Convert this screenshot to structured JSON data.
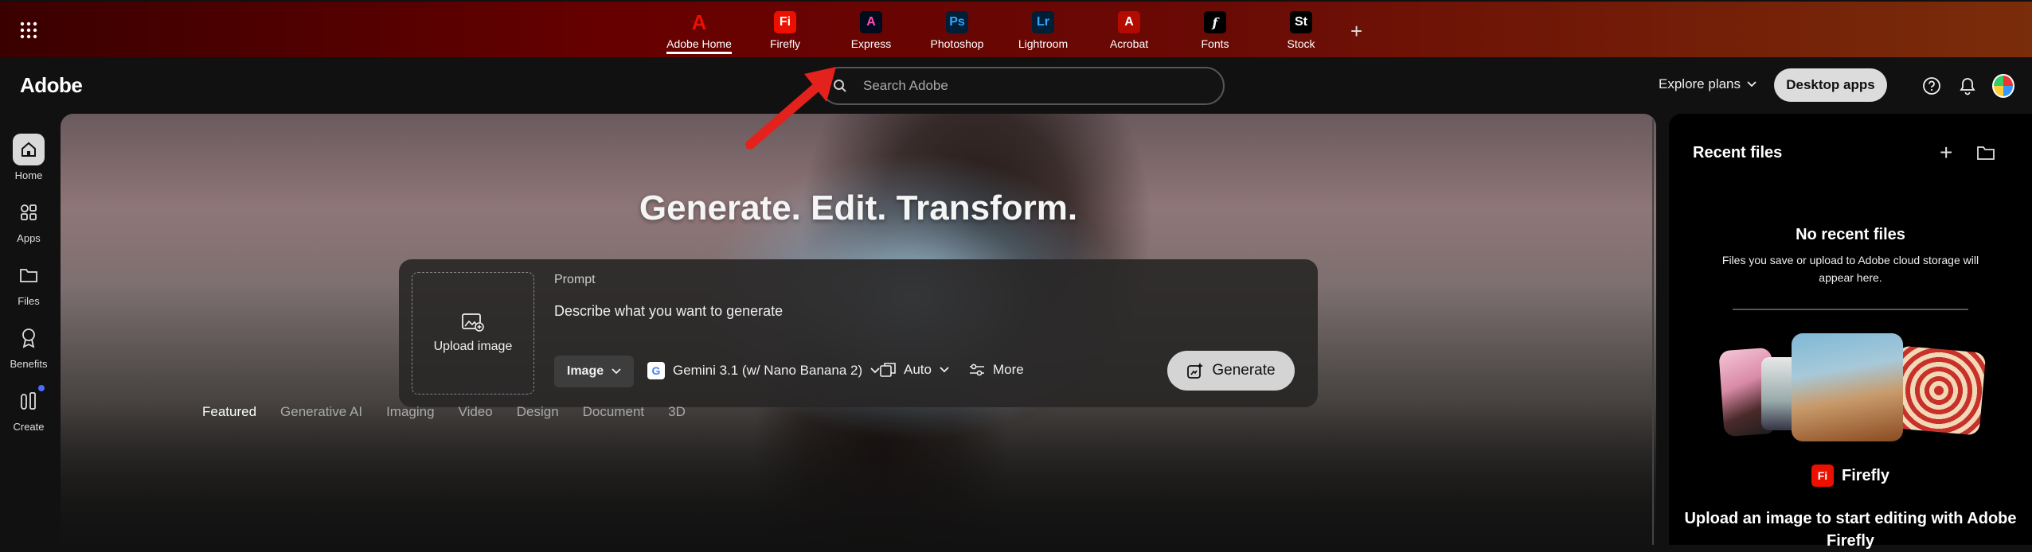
{
  "appbar": {
    "apps": [
      {
        "label": "Adobe Home",
        "icon": "adobe-home-icon",
        "glyph": "A",
        "color": "#eb1000",
        "bg": "transparent"
      },
      {
        "label": "Firefly",
        "icon": "firefly-icon",
        "glyph": "Fi",
        "color": "#ffffff",
        "bg": "#eb1000"
      },
      {
        "label": "Express",
        "icon": "express-icon",
        "glyph": "A",
        "color": "#ff4fb0",
        "bg": "#000b1d"
      },
      {
        "label": "Photoshop",
        "icon": "photoshop-icon",
        "glyph": "Ps",
        "color": "#31a8ff",
        "bg": "#001e36"
      },
      {
        "label": "Lightroom",
        "icon": "lightroom-icon",
        "glyph": "Lr",
        "color": "#31a8ff",
        "bg": "#001e36"
      },
      {
        "label": "Acrobat",
        "icon": "acrobat-icon",
        "glyph": "A",
        "color": "#ffffff",
        "bg": "#b30b00"
      },
      {
        "label": "Fonts",
        "icon": "fonts-icon",
        "glyph": "f",
        "color": "#ffffff",
        "bg": "#000000"
      },
      {
        "label": "Stock",
        "icon": "stock-icon",
        "glyph": "St",
        "color": "#ffffff",
        "bg": "#000000"
      }
    ],
    "add_label": "+"
  },
  "header": {
    "logo": "Adobe",
    "search_placeholder": "Search Adobe",
    "explore_label": "Explore plans",
    "desktop_label": "Desktop apps"
  },
  "leftnav": {
    "items": [
      {
        "label": "Home",
        "icon": "home-icon"
      },
      {
        "label": "Apps",
        "icon": "apps-icon"
      },
      {
        "label": "Files",
        "icon": "folder-icon"
      },
      {
        "label": "Benefits",
        "icon": "benefits-icon"
      },
      {
        "label": "Create",
        "icon": "create-icon"
      }
    ]
  },
  "hero": {
    "title": "Generate. Edit. Transform.",
    "upload_label": "Upload image",
    "prompt_label": "Prompt",
    "prompt_placeholder": "Describe what you want to generate",
    "type_label": "Image",
    "model_label": "Gemini 3.1 (w/ Nano Banana 2)",
    "aspect_label": "Auto",
    "more_label": "More",
    "generate_label": "Generate",
    "categories": [
      "Featured",
      "Generative AI",
      "Imaging",
      "Video",
      "Design",
      "Document",
      "3D"
    ]
  },
  "side": {
    "title": "Recent files",
    "empty_title": "No recent files",
    "empty_desc": "Files you save or upload to Adobe cloud storage will appear here.",
    "app_name": "Firefly",
    "app_glyph": "Fi",
    "cta": "Upload an image to start editing with Adobe Firefly"
  },
  "colors": {
    "accent": "#eb1000",
    "arrow": "#e3211d"
  }
}
